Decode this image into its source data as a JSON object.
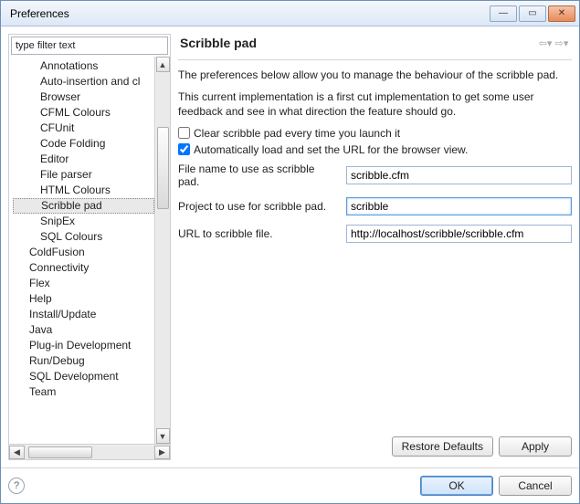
{
  "window": {
    "title": "Preferences"
  },
  "sidebar": {
    "filter_value": "type filter text",
    "items": [
      {
        "label": "Annotations",
        "indent": "sub"
      },
      {
        "label": "Auto-insertion and cl",
        "indent": "sub"
      },
      {
        "label": "Browser",
        "indent": "sub"
      },
      {
        "label": "CFML Colours",
        "indent": "sub"
      },
      {
        "label": "CFUnit",
        "indent": "sub"
      },
      {
        "label": "Code Folding",
        "indent": "sub"
      },
      {
        "label": "Editor",
        "indent": "sub"
      },
      {
        "label": "File parser",
        "indent": "sub"
      },
      {
        "label": "HTML Colours",
        "indent": "sub"
      },
      {
        "label": "Scribble pad",
        "indent": "sub",
        "selected": true
      },
      {
        "label": "SnipEx",
        "indent": "sub"
      },
      {
        "label": "SQL Colours",
        "indent": "sub"
      },
      {
        "label": "ColdFusion",
        "indent": "top"
      },
      {
        "label": "Connectivity",
        "indent": "top"
      },
      {
        "label": "Flex",
        "indent": "top"
      },
      {
        "label": "Help",
        "indent": "top"
      },
      {
        "label": "Install/Update",
        "indent": "top"
      },
      {
        "label": "Java",
        "indent": "top"
      },
      {
        "label": "Plug-in Development",
        "indent": "top"
      },
      {
        "label": "Run/Debug",
        "indent": "top"
      },
      {
        "label": "SQL Development",
        "indent": "top"
      },
      {
        "label": "Team",
        "indent": "top"
      }
    ]
  },
  "content": {
    "heading": "Scribble pad",
    "description": "The preferences below allow you to manage the behaviour of the scribble pad.",
    "implementation_note": "This current implementation is a first cut implementation to get some user feedback and see in what direction the feature should go.",
    "checkboxes": {
      "clear": {
        "label": "Clear scribble pad every time you launch it",
        "checked": false
      },
      "autoload": {
        "label": "Automatically load and set the URL for the browser view.",
        "checked": true
      }
    },
    "fields": {
      "filename": {
        "label": "File name to use as scribble pad.",
        "value": "scribble.cfm"
      },
      "project": {
        "label": "Project to use for scribble pad.",
        "value": "scribble"
      },
      "url": {
        "label": "URL to scribble file.",
        "value": "http://localhost/scribble/scribble.cfm"
      }
    },
    "buttons": {
      "restore_defaults": "Restore Defaults",
      "apply": "Apply"
    }
  },
  "footer": {
    "ok": "OK",
    "cancel": "Cancel"
  }
}
